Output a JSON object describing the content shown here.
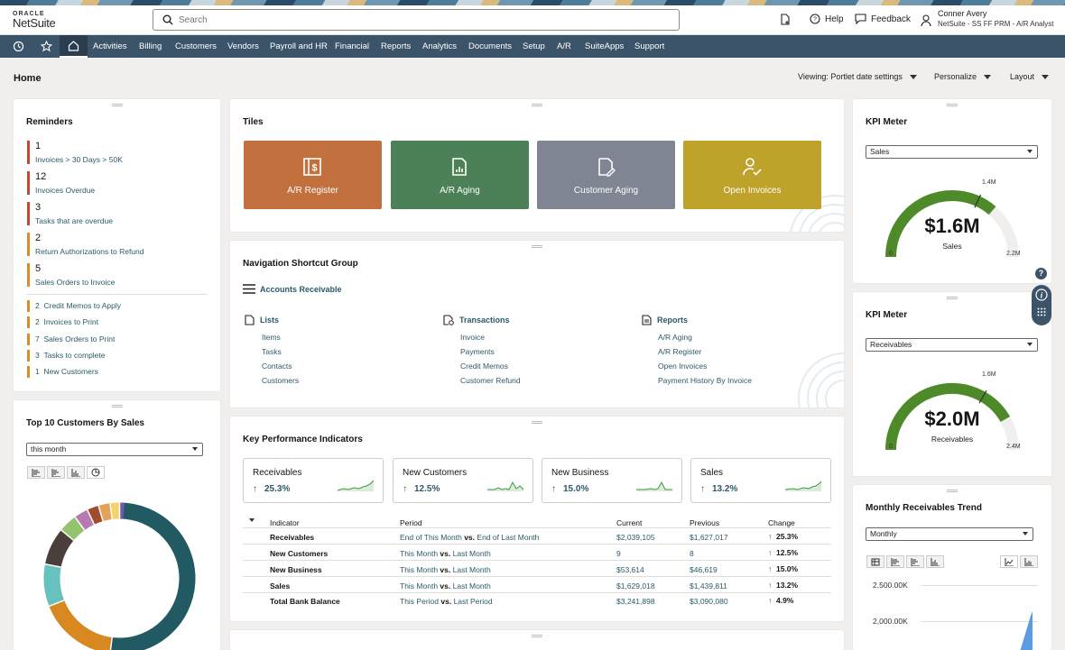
{
  "header": {
    "logo_top": "ORACLE",
    "logo_bottom": "NetSuite",
    "search_placeholder": "Search",
    "help": "Help",
    "feedback": "Feedback",
    "user_name": "Conner Avery",
    "user_role": "NetSuite - SS FF PRM - A/R Analyst"
  },
  "nav": {
    "items": [
      "Activities",
      "Billing",
      "Customers",
      "Vendors",
      "Payroll and HR",
      "Financial",
      "Reports",
      "Analytics",
      "Documents",
      "Setup",
      "A/R",
      "SuiteApps",
      "Support"
    ]
  },
  "page": {
    "title": "Home",
    "viewing": "Viewing: Portlet date settings",
    "personalize": "Personalize",
    "layout": "Layout"
  },
  "reminders": {
    "title": "Reminders",
    "major": [
      {
        "num": "1",
        "label": "Invoices > 30 Days > 50K",
        "color": "#c74634"
      },
      {
        "num": "12",
        "label": "Invoices Overdue",
        "color": "#c74634"
      },
      {
        "num": "3",
        "label": "Tasks that are overdue",
        "color": "#c74634"
      },
      {
        "num": "2",
        "label": "Return Authorizations to Refund",
        "color": "#dd8a2b"
      },
      {
        "num": "5",
        "label": "Sales Orders to Invoice",
        "color": "#dd8a2b"
      }
    ],
    "minor": [
      {
        "num": "2",
        "label": "Credit Memos to Apply"
      },
      {
        "num": "2",
        "label": "Invoices to Print"
      },
      {
        "num": "7",
        "label": "Sales Orders to Print"
      },
      {
        "num": "3",
        "label": "Tasks to complete"
      },
      {
        "num": "1",
        "label": "New Customers"
      }
    ]
  },
  "top10": {
    "title": "Top 10 Customers By Sales",
    "period": "this month",
    "slices": [
      "#215a62",
      "#d88821",
      "#67c2bf",
      "#4b3f3c",
      "#94c36e",
      "#b67bae",
      "#a14b2f",
      "#e5a35a",
      "#f3d36c",
      "#7058ad"
    ]
  },
  "tiles": {
    "title": "Tiles",
    "items": [
      {
        "label": "A/R Register",
        "color": "#c2713e",
        "icon": "register-icon"
      },
      {
        "label": "A/R Aging",
        "color": "#4c8056",
        "icon": "aging-report-icon"
      },
      {
        "label": "Customer Aging",
        "color": "#7f8592",
        "icon": "document-edit-icon"
      },
      {
        "label": "Open Invoices",
        "color": "#bea22a",
        "icon": "user-check-icon"
      }
    ]
  },
  "shortcuts": {
    "title": "Navigation Shortcut Group",
    "group": "Accounts Receivable",
    "columns": [
      {
        "heading": "Lists",
        "icon": "list-icon",
        "links": [
          "Items",
          "Tasks",
          "Contacts",
          "Customers"
        ]
      },
      {
        "heading": "Transactions",
        "icon": "transactions-icon",
        "links": [
          "Invoice",
          "Payments",
          "Credit Memos",
          "Customer Refund"
        ]
      },
      {
        "heading": "Reports",
        "icon": "reports-icon",
        "links": [
          "A/R Aging",
          "A/R Register",
          "Open Invoices",
          "Payment History By Invoice"
        ]
      }
    ]
  },
  "kpi": {
    "title": "Key Performance Indicators",
    "cards": [
      {
        "label": "Receivables",
        "value": "25.3%"
      },
      {
        "label": "New Customers",
        "value": "12.5%"
      },
      {
        "label": "New Business",
        "value": "15.0%"
      },
      {
        "label": "Sales",
        "value": "13.2%"
      }
    ],
    "headers": [
      "Indicator",
      "Period",
      "Current",
      "Previous",
      "Change"
    ],
    "rows": [
      {
        "indicator": "Receivables",
        "p1": "End of This Month",
        "vs": "vs.",
        "p2": "End of Last Month",
        "current": "$2,039,105",
        "previous": "$1,627,017",
        "change": "25.3%"
      },
      {
        "indicator": "New Customers",
        "p1": "This Month",
        "vs": "vs.",
        "p2": "Last Month",
        "current": "9",
        "previous": "8",
        "change": "12.5%"
      },
      {
        "indicator": "New Business",
        "p1": "This Month",
        "vs": "vs.",
        "p2": "Last Month",
        "current": "$53,614",
        "previous": "$46,619",
        "change": "15.0%"
      },
      {
        "indicator": "Sales",
        "p1": "This Month",
        "vs": "vs.",
        "p2": "Last Month",
        "current": "$1,629,018",
        "previous": "$1,439,811",
        "change": "13.2%"
      },
      {
        "indicator": "Total Bank Balance",
        "p1": "This Period",
        "vs": "vs.",
        "p2": "Last Period",
        "current": "$3,241,898",
        "previous": "$3,090,080",
        "change": "4.9%"
      }
    ]
  },
  "kpimeter1": {
    "title": "KPI Meter",
    "select": "Sales",
    "value": "$1.6M",
    "label": "Sales",
    "min": "0",
    "max": "2.2M",
    "marker": "1.4M",
    "value_num": 1.6,
    "max_num": 2.2,
    "marker_num": 1.4
  },
  "kpimeter2": {
    "title": "KPI Meter",
    "select": "Receivables",
    "value": "$2.0M",
    "label": "Receivables",
    "min": "0",
    "max": "2.4M",
    "marker": "1.6M",
    "value_num": 2.0,
    "max_num": 2.4,
    "marker_num": 1.6
  },
  "trend": {
    "title": "Monthly Receivables Trend",
    "select": "Monthly",
    "y1": "2,500.00K",
    "y2": "2,000.00K"
  }
}
